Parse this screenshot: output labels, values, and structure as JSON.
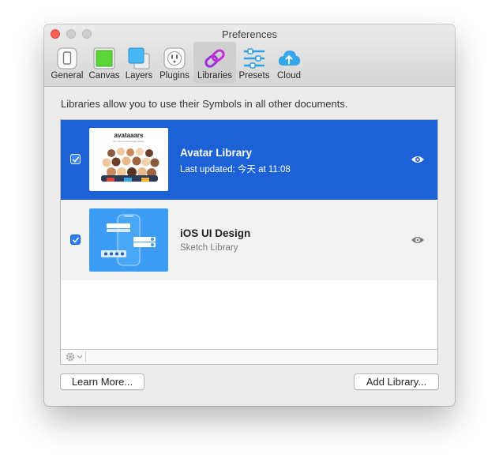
{
  "window": {
    "title": "Preferences"
  },
  "toolbar": {
    "items": [
      {
        "label": "General",
        "icon": "phone-icon"
      },
      {
        "label": "Canvas",
        "icon": "canvas-icon"
      },
      {
        "label": "Layers",
        "icon": "layers-icon"
      },
      {
        "label": "Plugins",
        "icon": "plug-icon"
      },
      {
        "label": "Libraries",
        "icon": "link-icon",
        "selected": true
      },
      {
        "label": "Presets",
        "icon": "sliders-icon"
      },
      {
        "label": "Cloud",
        "icon": "cloud-upload-icon"
      }
    ]
  },
  "libraries": {
    "description": "Libraries allow you to use their Symbols in all other documents.",
    "items": [
      {
        "name": "Avatar Library",
        "subtitle": "Last updated: 今天 at 11:08",
        "checked": true,
        "selected": true,
        "thumb_title": "avataaars",
        "thumb_subtitle": "the open-source avatar library"
      },
      {
        "name": "iOS UI Design",
        "subtitle": "Sketch Library",
        "checked": true,
        "selected": false
      }
    ]
  },
  "buttons": {
    "learn_more": "Learn More...",
    "add_library": "Add Library..."
  },
  "colors": {
    "selection": "#1c62d6",
    "accent": "#2e7bf7",
    "close": "#fc5f57"
  }
}
